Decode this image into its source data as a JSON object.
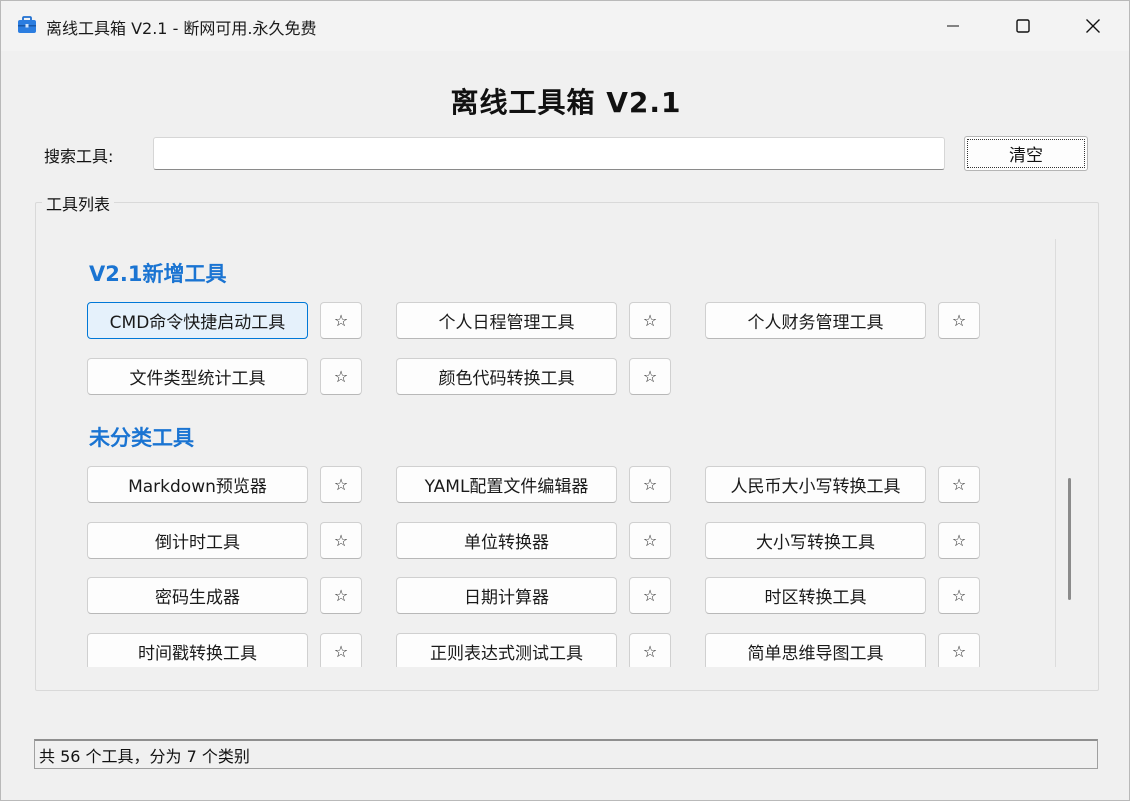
{
  "window": {
    "title": "离线工具箱 V2.1 - 断网可用.永久免费"
  },
  "header": {
    "app_title": "离线工具箱 V2.1"
  },
  "search": {
    "label": "搜索工具:",
    "value": "",
    "clear_label": "清空"
  },
  "tool_list": {
    "group_title": "工具列表",
    "star_label": "☆",
    "categories": [
      {
        "name": "V2.1新增工具",
        "tools": [
          "CMD命令快捷启动工具",
          "个人日程管理工具",
          "个人财务管理工具",
          "文件类型统计工具",
          "颜色代码转换工具"
        ]
      },
      {
        "name": "未分类工具",
        "tools": [
          "Markdown预览器",
          "YAML配置文件编辑器",
          "人民币大小写转换工具",
          "倒计时工具",
          "单位转换器",
          "大小写转换工具",
          "密码生成器",
          "日期计算器",
          "时区转换工具",
          "时间戳转换工具",
          "正则表达式测试工具",
          "简单思维导图工具"
        ]
      }
    ]
  },
  "status": {
    "text": "共 56 个工具，分为 7 个类别"
  },
  "colors": {
    "category": "#1a74d2",
    "focused_button": "#0078d7"
  }
}
